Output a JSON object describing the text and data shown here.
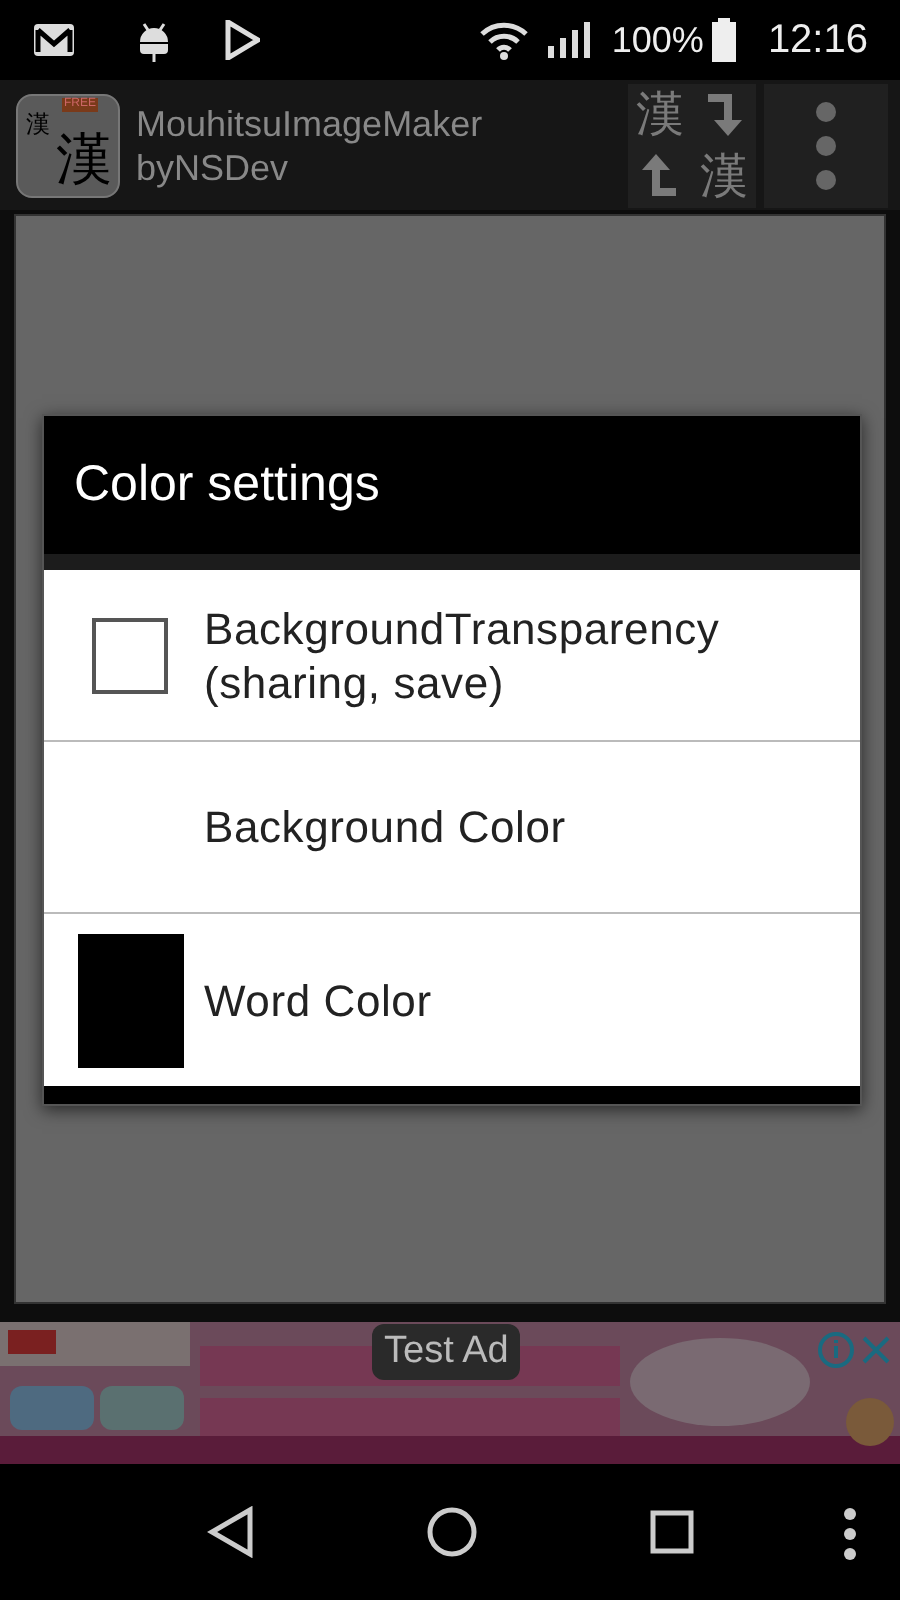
{
  "status_bar": {
    "battery": "100%",
    "time": "12:16"
  },
  "app_bar": {
    "icon": {
      "badge": "FREE",
      "small_char": "漢",
      "large_char": "漢"
    },
    "title": "MouhitsuImageMaker",
    "subtitle": "byNSDev",
    "convert_button": {
      "top_char": "漢",
      "bottom_char": "漢"
    }
  },
  "dialog": {
    "title": "Color settings",
    "rows": [
      {
        "kind": "checkbox",
        "label": "BackgroundTransparency (sharing, save)",
        "checked": false
      },
      {
        "kind": "plain",
        "label": "Background Color"
      },
      {
        "kind": "color",
        "label": "Word Color",
        "color": "#000000"
      }
    ]
  },
  "ad": {
    "label": "Test Ad"
  }
}
